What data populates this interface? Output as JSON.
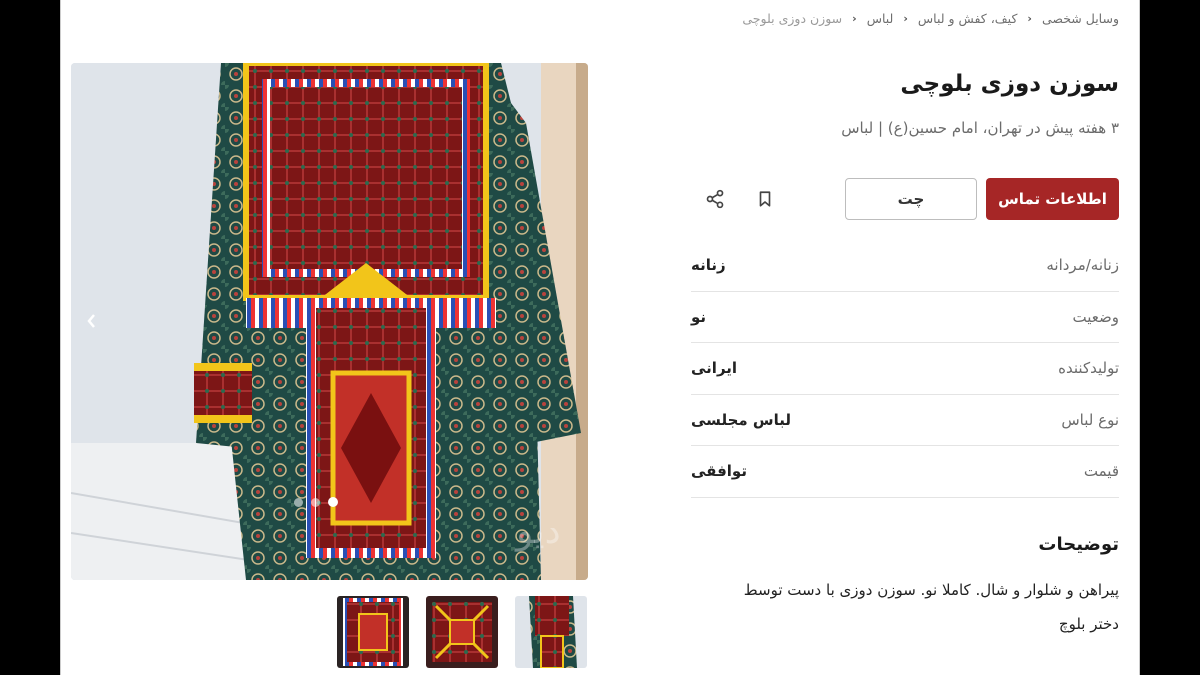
{
  "breadcrumb": [
    {
      "label": "وسایل شخصی"
    },
    {
      "label": "کیف، کفش و لباس"
    },
    {
      "label": "لباس"
    },
    {
      "label": "سوزن دوزی بلوچی"
    }
  ],
  "listing": {
    "title": "سوزن دوزی بلوچی",
    "subtitle": "۳ هفته پیش در تهران، امام حسین(ع) | لباس"
  },
  "actions": {
    "contact_label": "اطلاعات تماس",
    "chat_label": "چت"
  },
  "attributes": [
    {
      "label": "زنانه/مردانه",
      "value": "زنانه"
    },
    {
      "label": "وضعیت",
      "value": "نو"
    },
    {
      "label": "تولیدکننده",
      "value": "ایرانی"
    },
    {
      "label": "نوع لباس",
      "value": "لباس مجلسی"
    },
    {
      "label": "قیمت",
      "value": "توافقی"
    }
  ],
  "description": {
    "title": "توضیحات",
    "text": "پیراهن و شلوار و شال. کاملا نو. سوزن دوزی با دست توسط دختر بلوچ"
  },
  "gallery": {
    "active_index": 2,
    "dot_count": 3,
    "thumbnail_count": 3
  },
  "colors": {
    "accent": "#a62626"
  }
}
